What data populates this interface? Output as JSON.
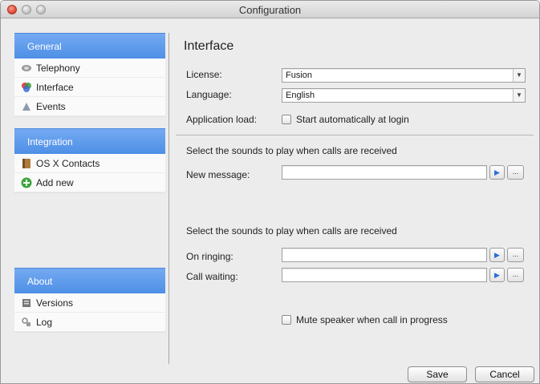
{
  "window": {
    "title": "Configuration"
  },
  "sidebar": {
    "groups": [
      {
        "header": "General",
        "items": [
          {
            "label": "Telephony",
            "icon": "telephone-icon"
          },
          {
            "label": "Interface",
            "icon": "palette-icon"
          },
          {
            "label": "Events",
            "icon": "events-icon"
          }
        ]
      },
      {
        "header": "Integration",
        "items": [
          {
            "label": "OS X Contacts",
            "icon": "address-book-icon"
          },
          {
            "label": "Add new",
            "icon": "add-icon"
          }
        ]
      },
      {
        "header": "About",
        "items": [
          {
            "label": "Versions",
            "icon": "versions-icon"
          },
          {
            "label": "Log",
            "icon": "log-icon"
          }
        ]
      }
    ]
  },
  "content": {
    "heading": "Interface",
    "license_label": "License:",
    "license_value": "Fusion",
    "language_label": "Language:",
    "language_value": "English",
    "app_load_label": "Application load:",
    "start_auto_label": "Start automatically at login",
    "sounds_section1_title": "Select the sounds to play when calls are received",
    "new_message_label": "New message:",
    "sounds_section2_title": "Select the sounds to play when calls are received",
    "on_ringing_label": "On ringing:",
    "call_waiting_label": "Call waiting:",
    "mute_label": "Mute speaker when call in progress",
    "play_glyph": "▶",
    "browse_glyph": "...",
    "dropdown_glyph": "▼"
  },
  "footer": {
    "save_label": "Save",
    "cancel_label": "Cancel"
  },
  "colors": {
    "accent": "#5a97ea",
    "play_icon": "#2c6fd6"
  }
}
